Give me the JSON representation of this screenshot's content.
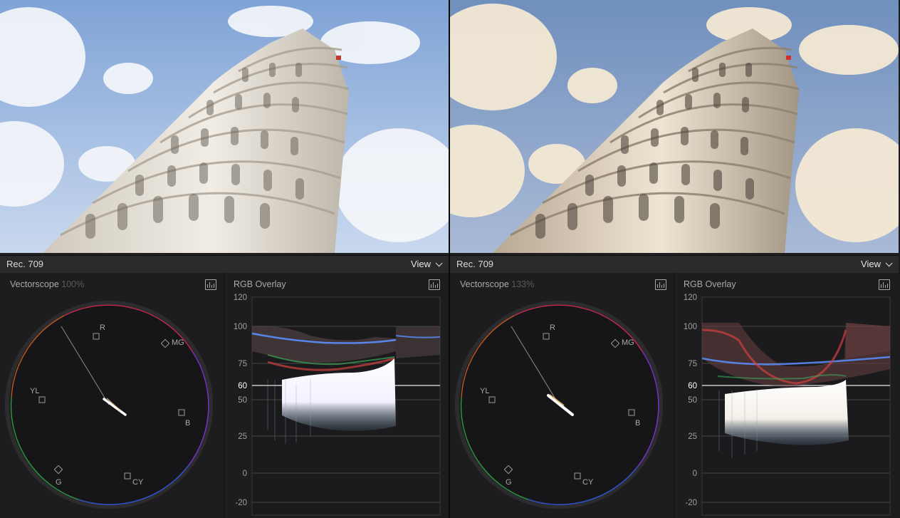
{
  "panels": [
    {
      "id": "left",
      "standard": "Rec. 709",
      "view_label": "View",
      "vectorscope": {
        "title": "Vectorscope",
        "zoom": "100%",
        "targets": {
          "R": "R",
          "MG": "MG",
          "B": "B",
          "CY": "CY",
          "G": "G",
          "YL": "YL"
        }
      },
      "waveform": {
        "title": "RGB Overlay",
        "scale": [
          "120",
          "100",
          "75",
          "60",
          "50",
          "25",
          "0",
          "-20"
        ]
      },
      "image": {
        "sky_top": "#7fa3d6",
        "sky_bottom": "#c9d8ee",
        "cloud": "#f4f6fa",
        "marble": "#e6e1d6"
      }
    },
    {
      "id": "right",
      "standard": "Rec. 709",
      "view_label": "View",
      "vectorscope": {
        "title": "Vectorscope",
        "zoom": "133%",
        "targets": {
          "R": "R",
          "MG": "MG",
          "B": "B",
          "CY": "CY",
          "G": "G",
          "YL": "YL"
        }
      },
      "waveform": {
        "title": "RGB Overlay",
        "scale": [
          "120",
          "100",
          "75",
          "60",
          "50",
          "25",
          "0",
          "-20"
        ]
      },
      "image": {
        "sky_top": "#6f8fbd",
        "sky_bottom": "#a9bad6",
        "cloud": "#f6ead4",
        "marble": "#e9dcc8"
      }
    }
  ]
}
